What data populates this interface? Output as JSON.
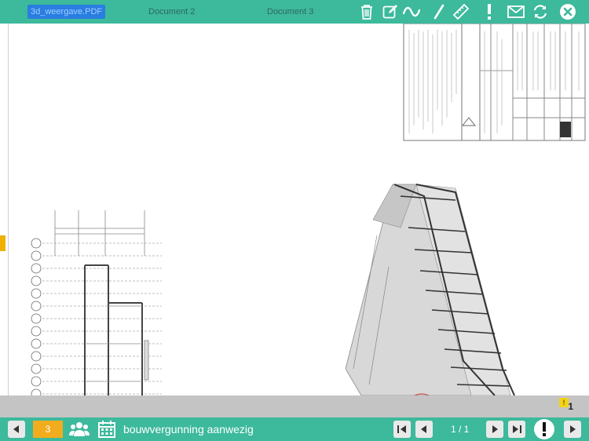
{
  "tabs": [
    {
      "label": "3d_weergave.PDF",
      "active": true
    },
    {
      "label": "Document 2",
      "active": false
    },
    {
      "label": "Document 3",
      "active": false
    }
  ],
  "toolbar_icons": [
    "trash-icon",
    "edit-icon",
    "freehand-icon",
    "line-icon",
    "ruler-icon",
    "exclamation-icon",
    "mail-icon",
    "refresh-icon",
    "close-icon"
  ],
  "notes": {
    "count": "1"
  },
  "bottombar": {
    "page_field": "3",
    "status": "bouwvergunning aanwezig",
    "page_counter": "1 / 1"
  },
  "colors": {
    "bar": "#3db99c",
    "active_tab": "#2a7de1",
    "page_field": "#f2ad1e",
    "strip": "#c4c4c4"
  }
}
